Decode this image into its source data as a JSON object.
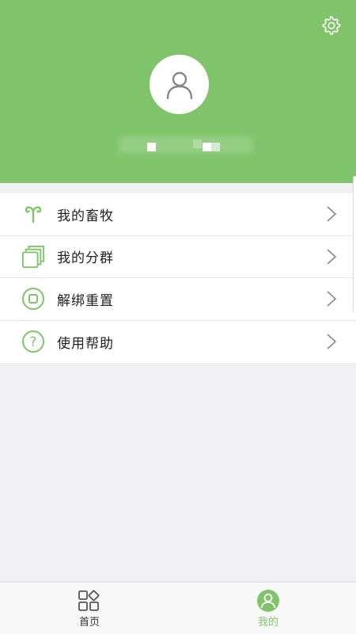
{
  "header": {
    "background_color": "#7fc46a",
    "settings_icon": "gear-icon",
    "avatar_icon": "user-icon"
  },
  "menu": {
    "items": [
      {
        "label": "我的畜牧",
        "icon": "ram-horns-icon"
      },
      {
        "label": "我的分群",
        "icon": "stacked-squares-icon"
      },
      {
        "label": "解绑重置",
        "icon": "unbind-circle-icon"
      },
      {
        "label": "使用帮助",
        "icon": "question-circle-icon"
      }
    ]
  },
  "tabbar": {
    "tabs": [
      {
        "label": "首页",
        "icon": "grid-icon",
        "active": false
      },
      {
        "label": "我的",
        "icon": "profile-icon",
        "active": true
      }
    ],
    "active_color": "#7fc46a"
  }
}
